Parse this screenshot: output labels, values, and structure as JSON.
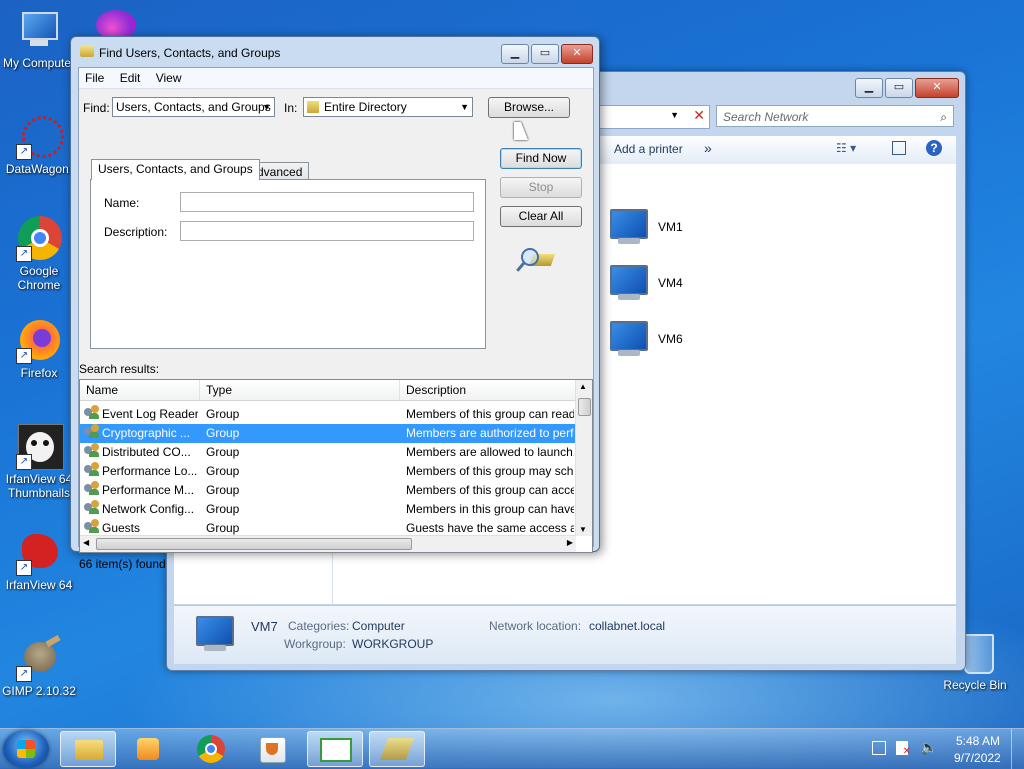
{
  "desktop": {
    "icons": [
      {
        "label": "My Computer",
        "key": "my-computer"
      },
      {
        "label": "DataWagon.",
        "key": "datawagon"
      },
      {
        "label": "Google Chrome",
        "key": "google-chrome"
      },
      {
        "label": "Firefox",
        "key": "firefox"
      },
      {
        "label": "IrfanView 64 Thumbnails",
        "key": "irfanview-thumbnails"
      },
      {
        "label": "IrfanView 64",
        "key": "irfanview"
      },
      {
        "label": "GIMP 2.10.32",
        "key": "gimp"
      },
      {
        "label": "Recycle Bin",
        "key": "recycle-bin"
      }
    ]
  },
  "explorer": {
    "search_placeholder": "Search Network",
    "toolbar": {
      "add_printer": "Add a printer",
      "more": "»"
    },
    "computers": [
      "VM1",
      "VM4",
      "VM6"
    ],
    "details": {
      "name": "VM7",
      "categories_label": "Categories:",
      "categories_value": "Computer",
      "workgroup_label": "Workgroup:",
      "workgroup_value": "WORKGROUP",
      "network_location_label": "Network location:",
      "network_location_value": "collabnet.local"
    }
  },
  "dialog": {
    "title": "Find Users, Contacts, and Groups",
    "menu": [
      "File",
      "Edit",
      "View"
    ],
    "find_label": "Find:",
    "find_value": "Users, Contacts, and Groups",
    "in_label": "In:",
    "in_value": "Entire Directory",
    "browse_button": "Browse...",
    "tabs": [
      "Users, Contacts, and Groups",
      "Advanced"
    ],
    "name_label": "Name:",
    "description_label": "Description:",
    "find_now_button": "Find Now",
    "stop_button": "Stop",
    "clear_all_button": "Clear All",
    "search_results_label": "Search results:",
    "columns": [
      "Name",
      "Type",
      "Description"
    ],
    "rows": [
      {
        "name": "Event Log Readers",
        "type": "Group",
        "description": "Members of this group can read"
      },
      {
        "name": "Cryptographic ...",
        "type": "Group",
        "description": "Members are authorized to perfo"
      },
      {
        "name": "Distributed CO...",
        "type": "Group",
        "description": "Members are allowed to launch,"
      },
      {
        "name": "Performance Lo...",
        "type": "Group",
        "description": "Members of this group may sch"
      },
      {
        "name": "Performance M...",
        "type": "Group",
        "description": "Members of this group can acce"
      },
      {
        "name": "Network Config...",
        "type": "Group",
        "description": "Members in this group can have"
      },
      {
        "name": "Guests",
        "type": "Group",
        "description": "Guests have the same access as"
      }
    ],
    "selected_row": 1,
    "status": "66 item(s) found"
  },
  "taskbar": {
    "time": "5:48 AM",
    "date": "9/7/2022"
  }
}
